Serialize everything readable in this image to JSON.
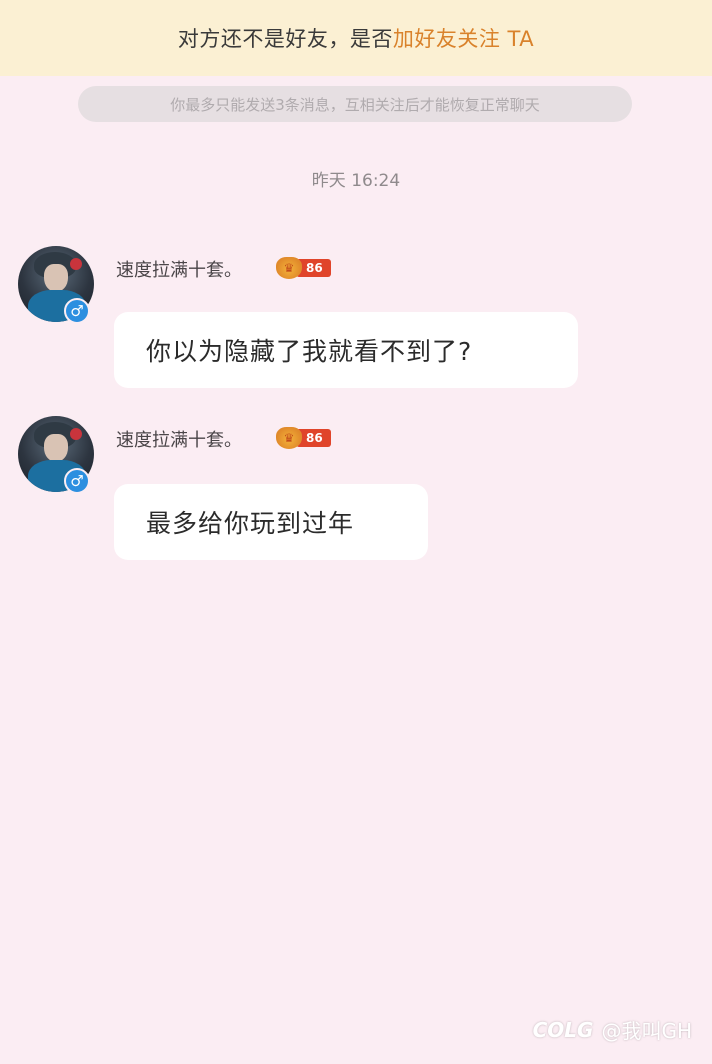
{
  "banner": {
    "prefix": "对方还不是好友，是否",
    "link_text": "加好友关注 TA"
  },
  "limit_notice": "你最多只能发送3条消息，互相关注后才能恢复正常聊天",
  "timestamp": "昨天 16:24",
  "messages": [
    {
      "username": "速度拉满十套。",
      "level": "86",
      "gender_symbol": "♂",
      "text": "你以为隐藏了我就看不到了?"
    },
    {
      "username": "速度拉满十套。",
      "level": "86",
      "gender_symbol": "♂",
      "text": "最多给你玩到过年"
    }
  ],
  "watermark": {
    "logo": "COLG",
    "text": "@我叫GH"
  },
  "colors": {
    "background": "#fbedf3",
    "banner": "#fbf0d3",
    "link": "#d9822b",
    "bubble": "#ffffff",
    "level_badge": "#e0442a",
    "gender_badge": "#2c8fe0"
  }
}
